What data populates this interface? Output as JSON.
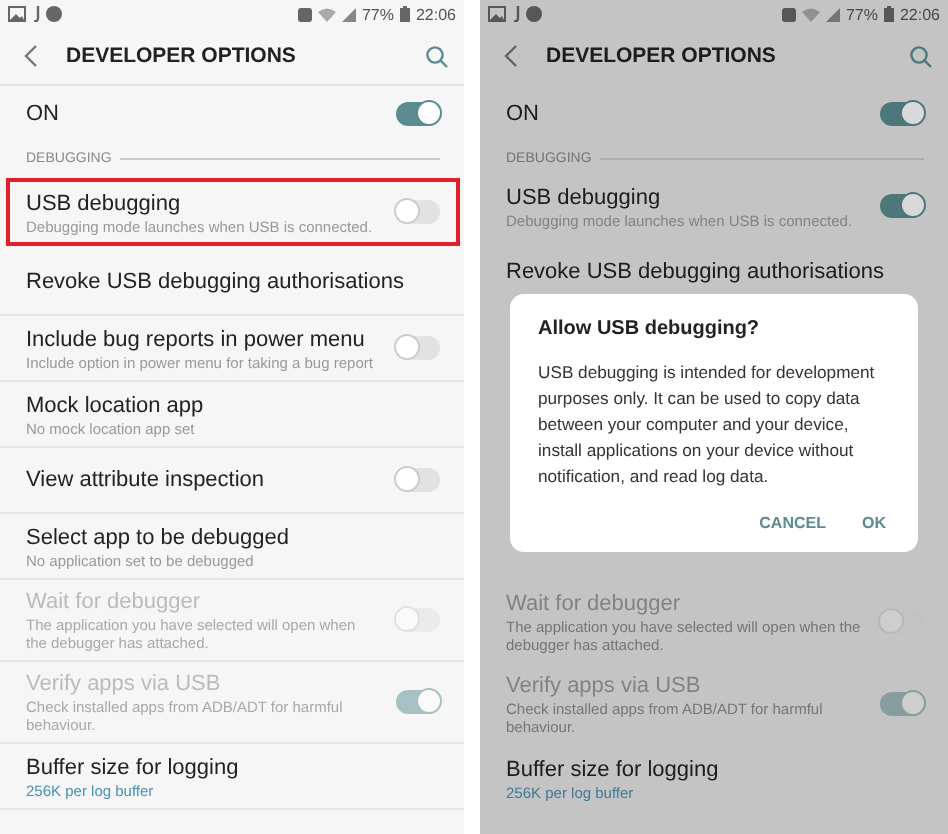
{
  "screens": [
    {
      "dimmed": false,
      "status_bar": {
        "battery": "77%",
        "time": "22:06"
      },
      "title": "DEVELOPER OPTIONS",
      "master": {
        "label": "ON",
        "on": true
      },
      "section": "DEBUGGING",
      "items": [
        {
          "kind": "switch",
          "title": "USB debugging",
          "subtitle": "Debugging mode launches when USB is connected.",
          "on": false,
          "disabled": false,
          "highlighted": true
        },
        {
          "kind": "plain",
          "title": "Revoke USB debugging authorisations",
          "disabled": false,
          "highlighted": false
        },
        {
          "kind": "switch",
          "title": "Include bug reports in power menu",
          "subtitle": "Include option in power menu for taking a bug report",
          "on": false,
          "disabled": false,
          "highlighted": false
        },
        {
          "kind": "plain",
          "title": "Mock location app",
          "subtitle": "No mock location app set",
          "disabled": false,
          "highlighted": false
        },
        {
          "kind": "switch",
          "title": "View attribute inspection",
          "on": false,
          "disabled": false,
          "highlighted": false
        },
        {
          "kind": "plain",
          "title": "Select app to be debugged",
          "subtitle": "No application set to be debugged",
          "disabled": false,
          "highlighted": false
        },
        {
          "kind": "switch",
          "title": "Wait for debugger",
          "subtitle": "The application you have selected will open when the debugger has attached.",
          "on": false,
          "disabled": true,
          "highlighted": false
        },
        {
          "kind": "switch",
          "title": "Verify apps via USB",
          "subtitle": "Check installed apps from ADB/ADT for harmful behaviour.",
          "on": true,
          "disabled": true,
          "highlighted": false
        },
        {
          "kind": "value",
          "title": "Buffer size for logging",
          "subtitle": "256K per log buffer",
          "disabled": false,
          "highlighted": false
        }
      ]
    },
    {
      "dimmed": true,
      "status_bar": {
        "battery": "77%",
        "time": "22:06"
      },
      "title": "DEVELOPER OPTIONS",
      "master": {
        "label": "ON",
        "on": true
      },
      "section": "DEBUGGING",
      "items": [
        {
          "kind": "switch",
          "title": "USB debugging",
          "subtitle": "Debugging mode launches when USB is connected.",
          "on": true,
          "disabled": false,
          "highlighted": false
        },
        {
          "kind": "plain",
          "title": "Revoke USB debugging authorisations",
          "disabled": false,
          "highlighted": false
        },
        {
          "kind": "dialog",
          "title": "Allow USB debugging?",
          "message": "USB debugging is intended for development purposes only. It can be used to copy data between your computer and your device, install applications on your device without notification, and read log data.",
          "buttons": [
            "CANCEL",
            "OK"
          ]
        },
        {
          "kind": "switch",
          "title": "Wait for debugger",
          "subtitle": "The application you have selected will open when the debugger has attached.",
          "on": false,
          "disabled": true,
          "highlighted": false
        },
        {
          "kind": "switch",
          "title": "Verify apps via USB",
          "subtitle": "Check installed apps from ADB/ADT for harmful behaviour.",
          "on": true,
          "disabled": true,
          "highlighted": false
        },
        {
          "kind": "value",
          "title": "Buffer size for logging",
          "subtitle": "256K per log buffer",
          "disabled": false,
          "highlighted": false
        }
      ]
    }
  ]
}
